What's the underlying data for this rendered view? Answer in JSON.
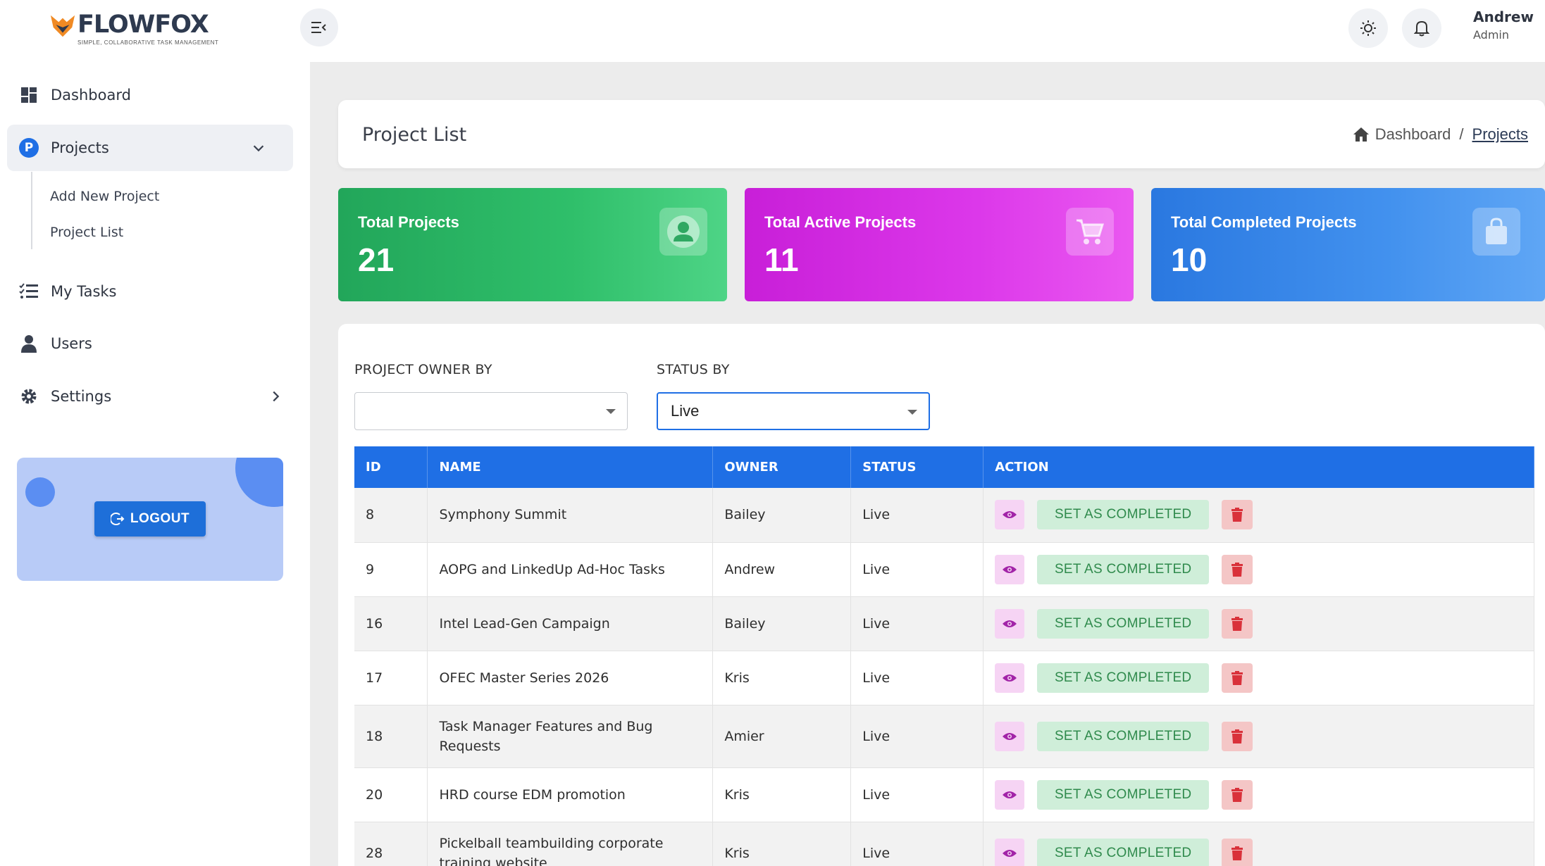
{
  "brand": {
    "name": "FLOWFOX",
    "tagline": "SIMPLE, COLLABORATIVE TASK MANAGEMENT"
  },
  "sidebar": {
    "items": [
      {
        "label": "Dashboard",
        "icon": "dashboard-icon"
      },
      {
        "label": "Projects",
        "icon": "p-badge-icon",
        "badge": "P"
      },
      {
        "label": "My Tasks",
        "icon": "tasks-list-icon"
      },
      {
        "label": "Users",
        "icon": "user-icon"
      },
      {
        "label": "Settings",
        "icon": "gear-icon"
      }
    ],
    "sub_items": [
      {
        "label": "Add New Project"
      },
      {
        "label": "Project List"
      }
    ],
    "logout_label": "LOGOUT"
  },
  "topbar": {
    "user_name": "Andrew",
    "user_role": "Admin"
  },
  "header": {
    "title": "Project List",
    "breadcrumb_home": "Dashboard",
    "breadcrumb_sep": "/",
    "breadcrumb_current": "Projects"
  },
  "stats": [
    {
      "title": "Total Projects",
      "value": "21",
      "color": "#2fbf6a",
      "icon": "user-circle-icon"
    },
    {
      "title": "Total Active Projects",
      "value": "11",
      "color": "#dc38ea",
      "icon": "cart-icon"
    },
    {
      "title": "Total Completed Projects",
      "value": "10",
      "color": "#4291ee",
      "icon": "bag-icon"
    }
  ],
  "filters": {
    "owner_label": "PROJECT OWNER BY",
    "owner_value": "",
    "status_label": "STATUS BY",
    "status_value": "Live"
  },
  "table": {
    "headers": [
      "ID",
      "NAME",
      "OWNER",
      "STATUS",
      "ACTION"
    ],
    "complete_label": "SET AS COMPLETED",
    "rows": [
      {
        "id": "8",
        "name": "Symphony Summit",
        "owner": "Bailey",
        "status": "Live"
      },
      {
        "id": "9",
        "name": "AOPG and LinkedUp Ad-Hoc Tasks",
        "owner": "Andrew",
        "status": "Live"
      },
      {
        "id": "16",
        "name": "Intel Lead-Gen Campaign",
        "owner": "Bailey",
        "status": "Live"
      },
      {
        "id": "17",
        "name": "OFEC Master Series 2026",
        "owner": "Kris",
        "status": "Live"
      },
      {
        "id": "18",
        "name": "Task Manager Features and Bug Requests",
        "owner": "Amier",
        "status": "Live"
      },
      {
        "id": "20",
        "name": "HRD course EDM promotion",
        "owner": "Kris",
        "status": "Live"
      },
      {
        "id": "28",
        "name": "Pickelball teambuilding corporate training website",
        "owner": "Kris",
        "status": "Live"
      }
    ]
  },
  "colors": {
    "primary": "#1f6fe5",
    "success_bg": "#cfeed9",
    "danger": "#d9313a",
    "view": "#a224a8"
  }
}
